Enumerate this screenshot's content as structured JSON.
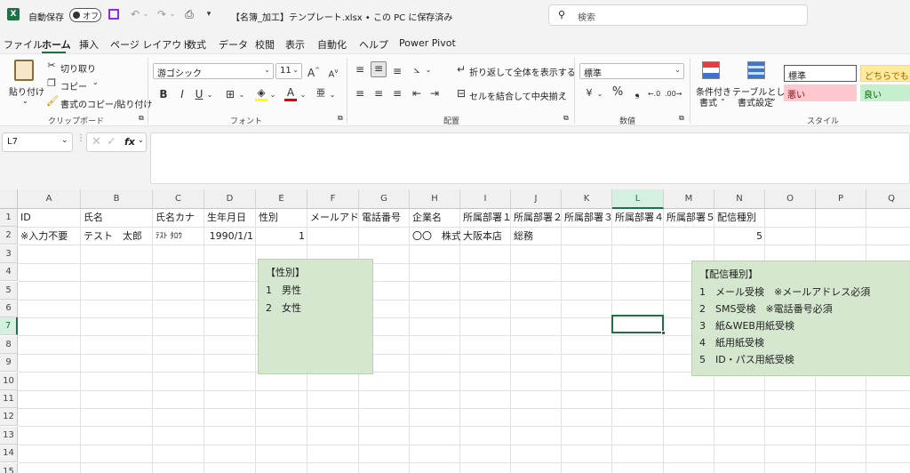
{
  "titlebar": {
    "autosave_label": "自動保存",
    "autosave_state": "オフ",
    "filename": "【名簿_加工】テンプレート.xlsx • この PC に保存済み",
    "search_placeholder": "検索"
  },
  "menu": [
    "ファイル",
    "ホーム",
    "挿入",
    "ページ レイアウト",
    "数式",
    "データ",
    "校閲",
    "表示",
    "自動化",
    "ヘルプ",
    "Power Pivot"
  ],
  "ribbon": {
    "clipboard": {
      "paste": "貼り付け",
      "cut": "切り取り",
      "copy": "コピー",
      "format_painter": "書式のコピー/貼り付け",
      "label": "クリップボード"
    },
    "font": {
      "font_name": "游ゴシック",
      "font_size": "11",
      "label": "フォント"
    },
    "alignment": {
      "wrap": "折り返して全体を表示する",
      "merge": "セルを結合して中央揃え",
      "label": "配置"
    },
    "number": {
      "format": "標準",
      "label": "数値"
    },
    "styles": {
      "conditional_l1": "条件付き",
      "conditional_l2": "書式",
      "table_l1": "テーブルとして",
      "table_l2": "書式設定",
      "standard": "標準",
      "neutral": "どちらでも",
      "bad": "悪い",
      "good": "良い",
      "label": "スタイル",
      "colors": {
        "standard_bg": "#ffffff",
        "neutral_bg": "#ffeb9c",
        "neutral_fg": "#9c6500",
        "bad_bg": "#ffc7ce",
        "bad_fg": "#9c0006",
        "good_bg": "#c6efce",
        "good_fg": "#006100"
      }
    }
  },
  "formula_bar": {
    "name_box": "L7",
    "fx": "fx",
    "content": ""
  },
  "grid": {
    "columns": [
      "A",
      "B",
      "C",
      "D",
      "E",
      "F",
      "G",
      "H",
      "I",
      "J",
      "K",
      "L",
      "M",
      "N",
      "O",
      "P",
      "Q"
    ],
    "rows": [
      "1",
      "2",
      "3",
      "4",
      "5",
      "6",
      "7",
      "8",
      "9",
      "10",
      "11",
      "12",
      "13",
      "14",
      "15"
    ],
    "selected_cell": "L7",
    "row1": [
      "ID",
      "氏名",
      "氏名カナ",
      "生年月日",
      "性別",
      "メールアドレス",
      "電話番号",
      "企業名",
      "所属部署１",
      "所属部署２",
      "所属部署３",
      "所属部署４",
      "所属部署５",
      "配信種別"
    ],
    "row2": [
      "※入力不要",
      "テスト　太郎",
      "ﾃｽﾄ ﾀﾛｳ",
      "1990/1/1",
      "1",
      "",
      "",
      "〇〇　株式会社",
      "大阪本店",
      "総務",
      "",
      "",
      "",
      "5"
    ]
  },
  "notes": {
    "gender": {
      "title": "【性別】",
      "lines": [
        "1　男性",
        "2　女性"
      ]
    },
    "delivery": {
      "title": "【配信種別】",
      "lines": [
        "1　メール受検　※メールアドレス必須",
        "2　SMS受検　※電話番号必須",
        "3　紙&WEB用紙受検",
        "4　紙用紙受検",
        "5　ID・パス用紙受検"
      ]
    }
  },
  "accent_color": "#1e7145"
}
